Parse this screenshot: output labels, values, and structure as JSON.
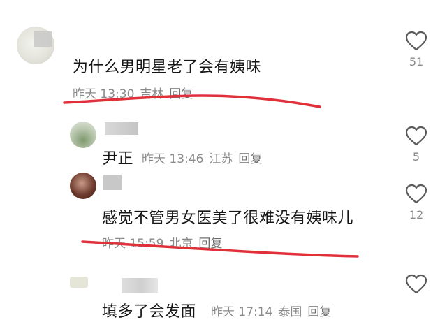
{
  "comments": [
    {
      "text": "为什么男明星老了会有姨味",
      "time": "昨天 13:30",
      "location": "吉林",
      "reply": "回复",
      "likes": "51"
    },
    {
      "text": "尹正",
      "time": "昨天 13:46",
      "location": "江苏",
      "reply": "回复",
      "likes": "5"
    },
    {
      "text": "感觉不管男女医美了很难没有姨味儿",
      "time": "昨天 15:59",
      "location": "北京",
      "reply": "回复",
      "likes": "12"
    },
    {
      "text": "填多了会发面",
      "time": "昨天 17:14",
      "location": "泰国",
      "reply": "回复",
      "likes": ""
    }
  ],
  "icons": {
    "like": "heart-outline-icon"
  },
  "colors": {
    "annotation": "#e0303a",
    "meta": "#8a8a8a"
  }
}
